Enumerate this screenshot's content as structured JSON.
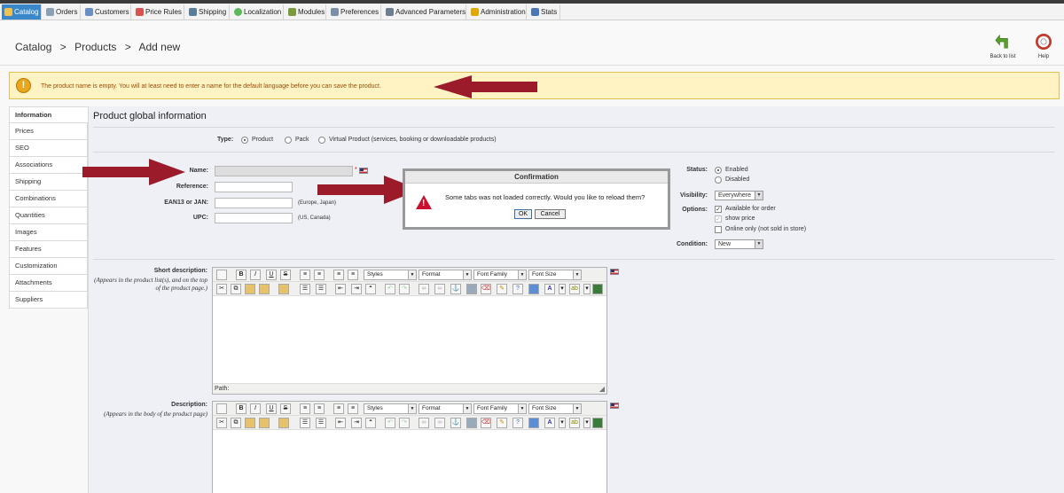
{
  "menu": {
    "tabs": [
      {
        "label": "Catalog",
        "active": true
      },
      {
        "label": "Orders"
      },
      {
        "label": "Customers"
      },
      {
        "label": "Price Rules"
      },
      {
        "label": "Shipping"
      },
      {
        "label": "Localization"
      },
      {
        "label": "Modules"
      },
      {
        "label": "Preferences"
      },
      {
        "label": "Advanced Parameters"
      },
      {
        "label": "Administration"
      },
      {
        "label": "Stats"
      }
    ]
  },
  "breadcrumb": {
    "items": [
      "Catalog",
      ">",
      "Products",
      ">",
      "Add new"
    ]
  },
  "header_buttons": {
    "back": "Back to list",
    "help": "Help"
  },
  "warning": {
    "text": "The product name is empty. You will at least need to enter a name for the default language before you can save the product."
  },
  "sidebar": {
    "items": [
      "Information",
      "Prices",
      "SEO",
      "Associations",
      "Shipping",
      "Combinations",
      "Quantities",
      "Images",
      "Features",
      "Customization",
      "Attachments",
      "Suppliers"
    ],
    "active": "Information"
  },
  "form": {
    "title": "Product global information",
    "type_label": "Type:",
    "type_options": [
      "Product",
      "Pack",
      "Virtual Product (services, booking or downloadable products)"
    ],
    "name_label": "Name:",
    "name_required": "*",
    "reference_label": "Reference:",
    "ean_label": "EAN13 or JAN:",
    "ean_hint": "(Europe, Japan)",
    "upc_label": "UPC:",
    "upc_hint": "(US, Canada)",
    "status_label": "Status:",
    "status_options": [
      "Enabled",
      "Disabled"
    ],
    "visibility_label": "Visibility:",
    "visibility_value": "Everywhere",
    "options_label": "Options:",
    "option_items": [
      "Available for order",
      "show price",
      "Online only (not sold in store)"
    ],
    "condition_label": "Condition:",
    "condition_value": "New",
    "short_desc_label": "Short description:",
    "short_desc_hint": "(Appears in the product list(s), and on the top of the product page.)",
    "desc_label": "Description:",
    "desc_hint": "(Appears in the body of the product page)"
  },
  "editor": {
    "styles": "Styles",
    "format": "Format",
    "font_family": "Font Family",
    "font_size": "Font Size",
    "path": "Path:"
  },
  "dialog": {
    "title": "Confirmation",
    "message": "Some tabs was not loaded correctly. Would you like to reload them?",
    "ok": "OK",
    "cancel": "Cancel"
  },
  "colors": {
    "active_tab": "#3a88c9",
    "warning_bg": "#fff3c4",
    "arrow": "#9b1b2a"
  }
}
